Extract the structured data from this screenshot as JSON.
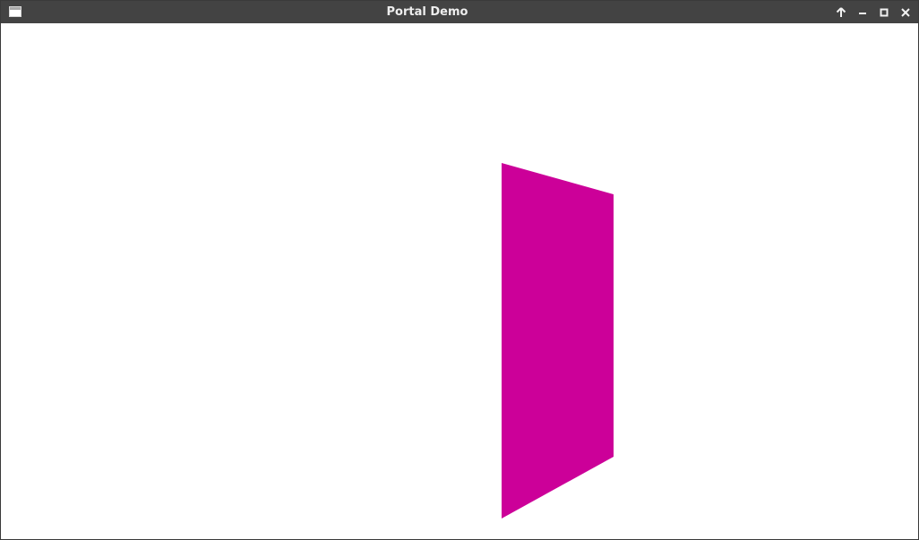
{
  "window": {
    "title": "Portal Demo",
    "icon": "app-window-icon",
    "controls": [
      "keep-above-icon",
      "minimize-icon",
      "maximize-icon",
      "close-icon"
    ]
  },
  "scene": {
    "portal_color": "#cc0099",
    "background_color": "#ffffff"
  }
}
